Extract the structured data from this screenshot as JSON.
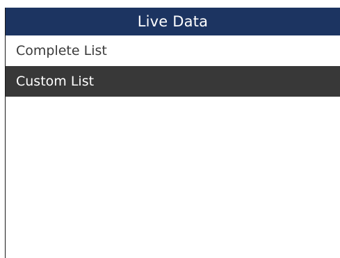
{
  "header": {
    "title": "Live Data"
  },
  "menu": {
    "items": [
      {
        "label": "Complete List",
        "selected": false
      },
      {
        "label": "Custom List",
        "selected": true
      }
    ]
  },
  "colors": {
    "header_bg": "#1c3461",
    "selected_bg": "#383838"
  }
}
